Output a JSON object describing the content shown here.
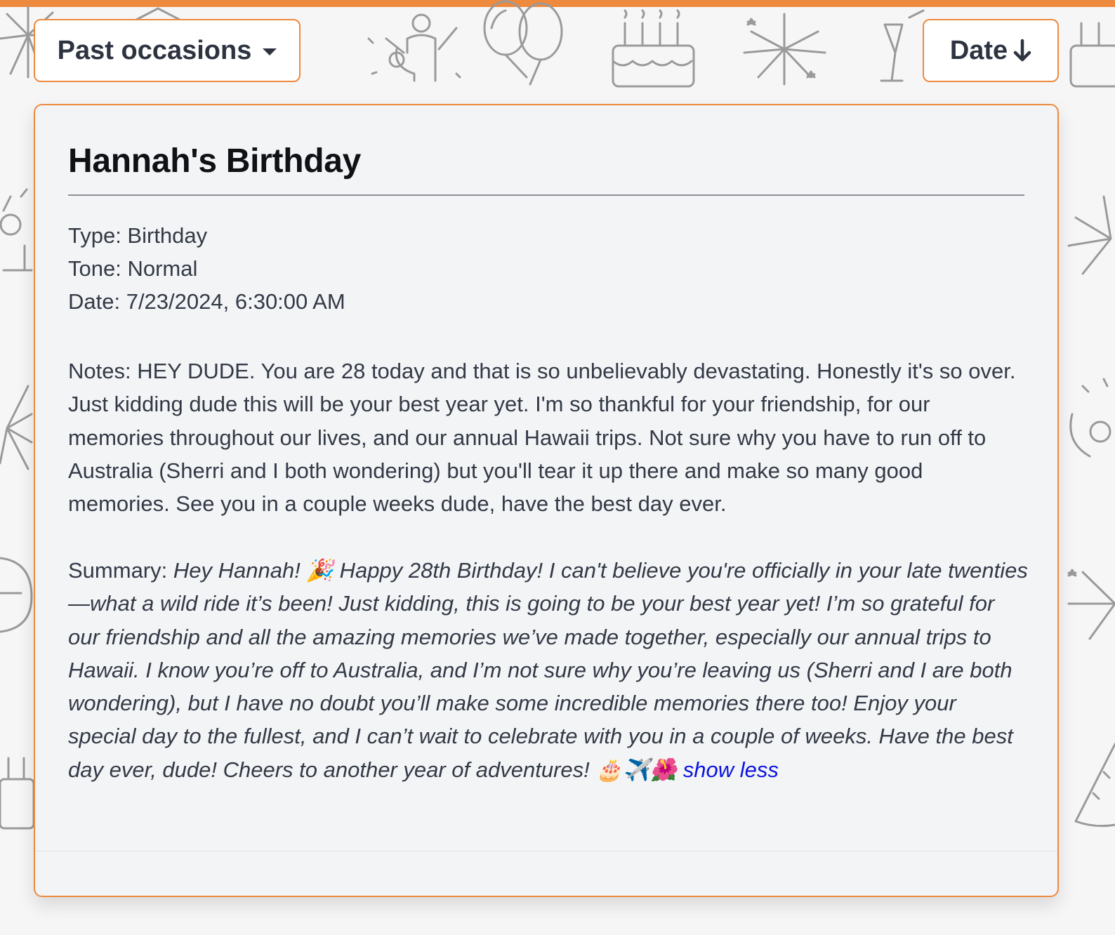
{
  "header": {
    "filter_label": "Past occasions",
    "sort_label": "Date"
  },
  "occasion": {
    "title": "Hannah's Birthday",
    "type_line": "Type: Birthday",
    "tone_line": "Tone: Normal",
    "date_line": "Date: 7/23/2024, 6:30:00 AM",
    "notes": "Notes: HEY DUDE. You are 28 today and that is so unbelievably devastating. Honestly it's so over. Just kidding dude this will be your best year yet. I'm so thankful for your friendship, for our memories throughout our lives, and our annual Hawaii trips. Not sure why you have to run off to Australia (Sherri and I both wondering) but you'll tear it up there and make so many good memories. See you in a couple weeks dude, have the best day ever.",
    "summary_label": "Summary: ",
    "summary": "Hey Hannah! 🎉 Happy 28th Birthday! I can't believe you're officially in your late twenties—what a wild ride it’s been! Just kidding, this is going to be your best year yet! I’m so grateful for our friendship and all the amazing memories we’ve made together, especially our annual trips to Hawaii. I know you’re off to Australia, and I’m not sure why you’re leaving us (Sherri and I are both wondering), but I have no doubt you’ll make some incredible memories there too! Enjoy your special day to the fullest, and I can’t wait to celebrate with you in a couple of weeks. Have the best day ever, dude! Cheers to another year of adventures! 🎂✈️🌺",
    "show_less_label": "show less"
  },
  "colors": {
    "accent": "#ed8a3e",
    "card_background": "#f3f4f6",
    "link": "#0a14e0"
  },
  "icons": [
    "caret-down-icon",
    "arrow-down-icon",
    "party-background-pattern"
  ]
}
